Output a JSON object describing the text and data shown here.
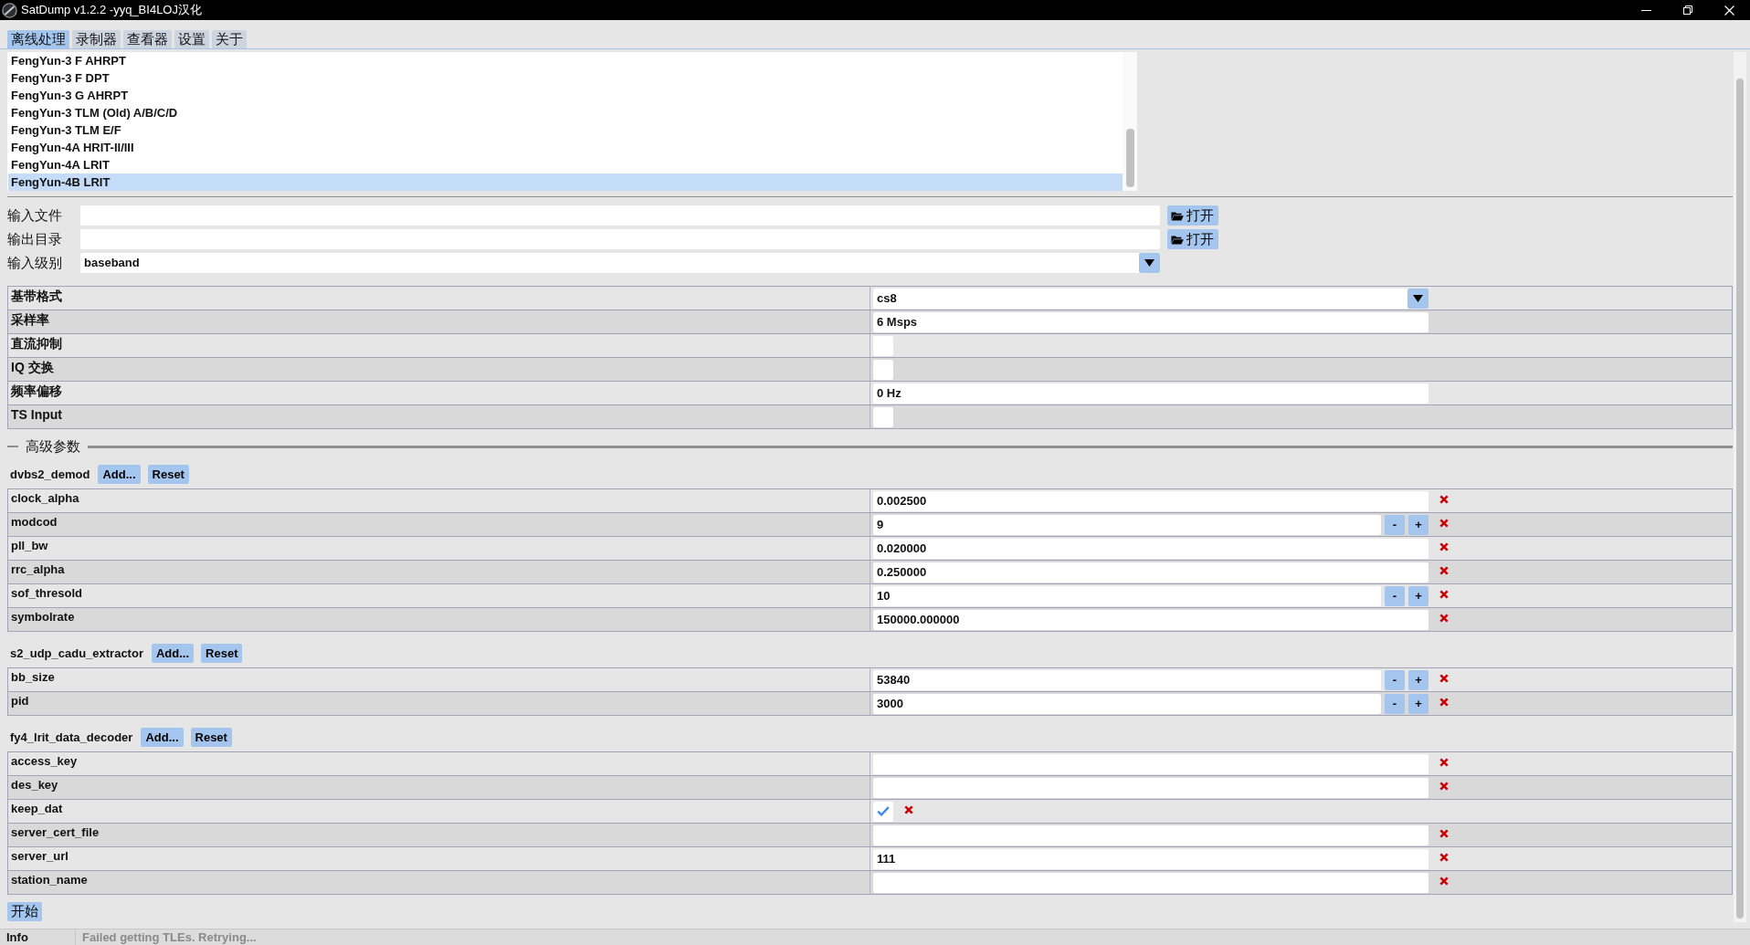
{
  "window": {
    "title": "SatDump v1.2.2 -yyq_BI4LOJ汉化"
  },
  "tabs": [
    {
      "label": "离线处理",
      "selected": true
    },
    {
      "label": "录制器",
      "selected": false
    },
    {
      "label": "查看器",
      "selected": false
    },
    {
      "label": "设置",
      "selected": false
    },
    {
      "label": "关于",
      "selected": false
    }
  ],
  "pipeline_list": [
    {
      "label": "FengYun-3 F AHRPT",
      "selected": false
    },
    {
      "label": "FengYun-3 F DPT",
      "selected": false
    },
    {
      "label": "FengYun-3 G AHRPT",
      "selected": false
    },
    {
      "label": "FengYun-3 TLM (Old) A/B/C/D",
      "selected": false
    },
    {
      "label": "FengYun-3 TLM E/F",
      "selected": false
    },
    {
      "label": "FengYun-4A HRIT-II/III",
      "selected": false
    },
    {
      "label": "FengYun-4A LRIT",
      "selected": false
    },
    {
      "label": "FengYun-4B LRIT",
      "selected": true
    }
  ],
  "io_fields": [
    {
      "label": "输入文件",
      "kind": "path",
      "button": "打开"
    },
    {
      "label": "输出目录",
      "kind": "path",
      "button": "打开"
    },
    {
      "label": "输入级别",
      "kind": "dropdown",
      "value": "baseband"
    }
  ],
  "source_parameters": [
    {
      "label": "基带格式",
      "kind": "dropdown",
      "value": "cs8"
    },
    {
      "label": "采样率",
      "kind": "text",
      "value": "6 Msps"
    },
    {
      "label": "直流抑制",
      "kind": "checkbox",
      "checked": false
    },
    {
      "label": "IQ 交换",
      "kind": "checkbox",
      "checked": false
    },
    {
      "label": "频率偏移",
      "kind": "text",
      "value": "0 Hz"
    },
    {
      "label": "TS Input",
      "kind": "checkbox",
      "checked": false
    }
  ],
  "advanced": {
    "title": "高级参数",
    "modules": [
      {
        "name": "dvbs2_demod",
        "add_button": "Add...",
        "reset_button": "Reset",
        "parameters": [
          {
            "label": "clock_alpha",
            "kind": "text",
            "value": "0.002500"
          },
          {
            "label": "modcod",
            "kind": "spin",
            "value": "9",
            "decrement": "-",
            "increment": "+"
          },
          {
            "label": "pll_bw",
            "kind": "text",
            "value": "0.020000"
          },
          {
            "label": "rrc_alpha",
            "kind": "text",
            "value": "0.250000"
          },
          {
            "label": "sof_thresold",
            "kind": "spin",
            "value": "10",
            "decrement": "-",
            "increment": "+"
          },
          {
            "label": "symbolrate",
            "kind": "text",
            "value": "150000.000000"
          }
        ]
      },
      {
        "name": "s2_udp_cadu_extractor",
        "add_button": "Add...",
        "reset_button": "Reset",
        "parameters": [
          {
            "label": "bb_size",
            "kind": "spin",
            "value": "53840",
            "decrement": "-",
            "increment": "+"
          },
          {
            "label": "pid",
            "kind": "spin",
            "value": "3000",
            "decrement": "-",
            "increment": "+"
          }
        ]
      },
      {
        "name": "fy4_lrit_data_decoder",
        "add_button": "Add...",
        "reset_button": "Reset",
        "parameters": [
          {
            "label": "access_key",
            "kind": "text"
          },
          {
            "label": "des_key",
            "kind": "text"
          },
          {
            "label": "keep_dat",
            "kind": "checkbox",
            "checked": true
          },
          {
            "label": "server_cert_file",
            "kind": "text"
          },
          {
            "label": "server_url",
            "kind": "text",
            "value": "111"
          },
          {
            "label": "station_name",
            "kind": "text"
          }
        ]
      }
    ]
  },
  "start_button": "开始",
  "status_bar": {
    "level": "Info",
    "message": "Failed getting TLEs. Retrying..."
  }
}
